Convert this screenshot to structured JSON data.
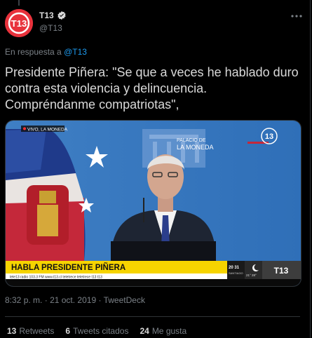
{
  "author": {
    "name": "T13",
    "handle": "@T13",
    "logo_text": "T13",
    "verified_icon": "verified-badge-icon",
    "brand_color": "#e8323c"
  },
  "reply_context": {
    "prefix": "En respuesta a",
    "mention": "@T13"
  },
  "tweet": {
    "text": "Presidente Piñera: \"Se que a veces he hablado duro contra esta violencia y delincuencia. Compréndanme compatriotas\","
  },
  "media": {
    "live_tag": "VIVO, LA MONEDA",
    "venue_top": "PALACIO DE",
    "venue_bottom": "LA MONEDA",
    "channel_logo": "13",
    "banner": "HABLA PRESIDENTE PIÑERA",
    "clock_time": "20 31",
    "clock_city": "SANTIAGO",
    "clock_temps": "21° 28°",
    "corner_logo": "T13",
    "ticker": "tele13 radio 103.3 FM   www.t13.cl   teletrece   teletrece   t13   t13"
  },
  "meta": {
    "time": "8:32 p. m.",
    "separator": "·",
    "date": "21 oct. 2019",
    "source": "TweetDeck"
  },
  "stats": {
    "retweets_count": "13",
    "retweets_label": "Retweets",
    "quotes_count": "6",
    "quotes_label": "Tweets citados",
    "likes_count": "24",
    "likes_label": "Me gusta"
  },
  "colors": {
    "accent": "#1d9bf0",
    "muted": "#7b8187",
    "banner": "#f6d400"
  }
}
